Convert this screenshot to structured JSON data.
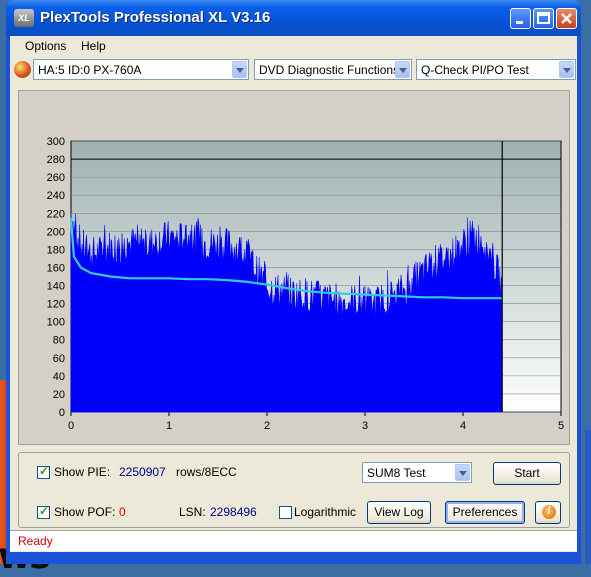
{
  "window": {
    "title": "PlexTools Professional XL V3.16",
    "icon_label": "XL"
  },
  "menu": {
    "items": [
      "Options",
      "Help"
    ]
  },
  "toolbar": {
    "drive": "HA:5 ID:0  PX-760A",
    "function": "DVD Diagnostic Functions",
    "test": "Q-Check PI/PO Test"
  },
  "chart_data": {
    "type": "area",
    "x_ticks": [
      "0",
      "1",
      "2",
      "3",
      "4",
      "5"
    ],
    "y_ticks": [
      "0",
      "20",
      "40",
      "60",
      "80",
      "100",
      "120",
      "140",
      "160",
      "180",
      "200",
      "220",
      "240",
      "260",
      "280",
      "300"
    ],
    "xlim": [
      0,
      5
    ],
    "ylim": [
      0,
      300
    ],
    "data_end_x": 4.4,
    "grid": true,
    "series": [
      {
        "kind": "bars",
        "color": "#0000ff",
        "x": [
          0.0,
          0.05,
          0.1,
          0.2,
          0.3,
          0.4,
          0.5,
          0.6,
          0.7,
          0.8,
          0.9,
          1.0,
          1.1,
          1.2,
          1.3,
          1.4,
          1.5,
          1.6,
          1.7,
          1.8,
          1.9,
          2.0,
          2.1,
          2.2,
          2.3,
          2.4,
          2.5,
          2.6,
          2.7,
          2.8,
          2.9,
          3.0,
          3.1,
          3.2,
          3.3,
          3.4,
          3.5,
          3.6,
          3.7,
          3.8,
          3.9,
          4.0,
          4.1,
          4.2,
          4.3,
          4.4
        ],
        "y": [
          225,
          205,
          190,
          180,
          182,
          188,
          186,
          192,
          190,
          190,
          195,
          198,
          196,
          200,
          195,
          192,
          190,
          190,
          186,
          180,
          160,
          145,
          140,
          138,
          135,
          135,
          132,
          130,
          128,
          128,
          128,
          125,
          125,
          130,
          135,
          140,
          150,
          160,
          170,
          175,
          180,
          190,
          200,
          195,
          175,
          145
        ]
      },
      {
        "kind": "line",
        "color": "#33ccdd",
        "x": [
          0.0,
          0.03,
          0.1,
          0.2,
          0.4,
          0.6,
          0.8,
          1.0,
          1.2,
          1.4,
          1.6,
          1.8,
          2.0,
          2.2,
          2.4,
          2.6,
          2.8,
          3.0,
          3.2,
          3.4,
          3.6,
          3.8,
          4.0,
          4.2,
          4.4
        ],
        "y": [
          215,
          172,
          160,
          154,
          150,
          148,
          148,
          148,
          147,
          147,
          146,
          144,
          141,
          137,
          134,
          132,
          131,
          130,
          129,
          128,
          127,
          127,
          126,
          126,
          126
        ]
      }
    ]
  },
  "controls": {
    "show_pie_label": "Show PIE:",
    "pie_value": "2250907",
    "pie_unit": "rows/8ECC",
    "show_pof_label": "Show POF:",
    "pof_value": "0",
    "lsn_label": "LSN:",
    "lsn_value": "2298496",
    "logarithmic_label": "Logarithmic",
    "sum_select": "SUM8 Test",
    "start_button": "Start",
    "view_log_button": "View Log",
    "preferences_button": "Preferences",
    "info_glyph": "i"
  },
  "status": {
    "text": "Ready"
  },
  "desktop": {
    "fragment_text": "ws"
  },
  "colors": {
    "plot_bg_top": "#9fb0b0",
    "plot_bg_bottom": "#ffffff",
    "bars": "#0000ff",
    "line": "#33ccdd",
    "status_text": "#d40000"
  }
}
